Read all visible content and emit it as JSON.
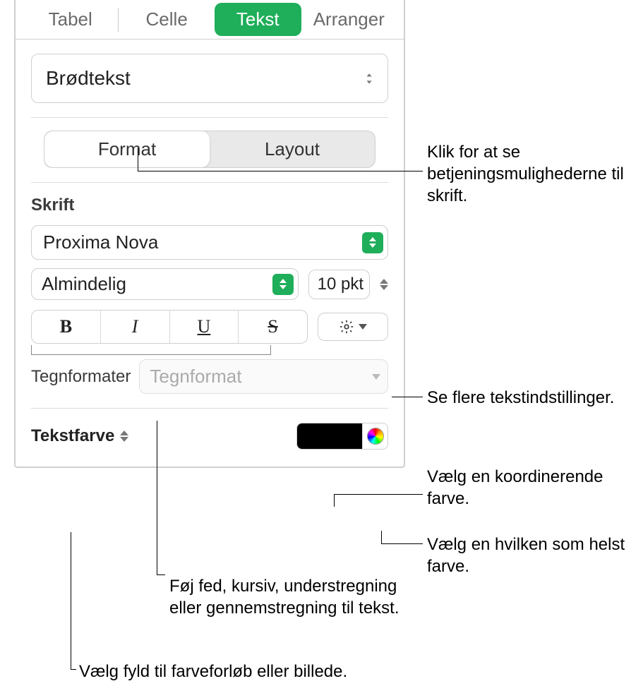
{
  "tabs": {
    "tabel": "Tabel",
    "celle": "Celle",
    "tekst": "Tekst",
    "arranger": "Arranger"
  },
  "paragraph_style": "Brødtekst",
  "subtabs": {
    "format": "Format",
    "layout": "Layout"
  },
  "font_section_label": "Skrift",
  "font_family": "Proxima Nova",
  "font_weight": "Almindelig",
  "font_size": "10 pkt",
  "char_formats_label": "Tegnformater",
  "char_formats_placeholder": "Tegnformat",
  "text_color_label": "Tekstfarve",
  "callouts": {
    "format_tab": "Klik for at se betjeningsmulighederne til skrift.",
    "gear": "Se flere tekstindstillinger.",
    "coord_color": "Vælg en koordinerende farve.",
    "any_color": "Vælg en hvilken som helst farve.",
    "biu": "Føj fed, kursiv, understregning eller gennemstregning til tekst.",
    "fill": "Vælg fyld til farveforløb eller billede."
  }
}
